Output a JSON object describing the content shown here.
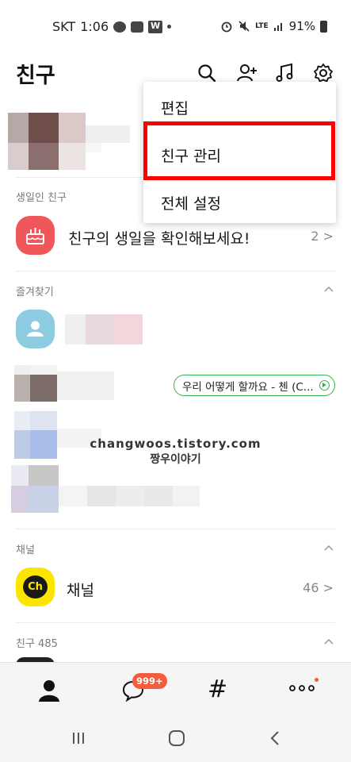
{
  "status_bar": {
    "carrier": "SKT",
    "time": "1:06",
    "app_icon_w": "W",
    "network": "LTE",
    "battery": "91%"
  },
  "header": {
    "title": "친구",
    "icons": [
      "search-icon",
      "add-friend-icon",
      "music-icon",
      "settings-icon"
    ]
  },
  "menu": {
    "items": [
      {
        "label": "편집"
      },
      {
        "label": "친구 관리"
      },
      {
        "label": "전체 설정"
      }
    ]
  },
  "sections": {
    "birthday": {
      "label": "생일인 친구",
      "row_text": "친구의 생일을 확인해보세요!",
      "count": "2 >"
    },
    "favorites": {
      "label": "즐겨찾기",
      "status_message": "우리 어떻게 할까요 - 첸 (C..."
    },
    "channel": {
      "label": "채널",
      "row_text": "채널",
      "icon_text": "Ch",
      "count": "46 >"
    },
    "friends": {
      "label": "친구 485"
    }
  },
  "watermark": {
    "line1": "changwoos.tistory.com",
    "line2": "짱우이야기"
  },
  "bottom_nav": {
    "chat_badge": "999+",
    "hash_label": "#",
    "more_label": "ooo"
  },
  "colors": {
    "highlight": "#ff0000",
    "badge": "#f35c3c",
    "birthday_icon_bg": "#f0575a",
    "channel_icon_bg": "#fee500",
    "status_pill_border": "#36b24a"
  }
}
